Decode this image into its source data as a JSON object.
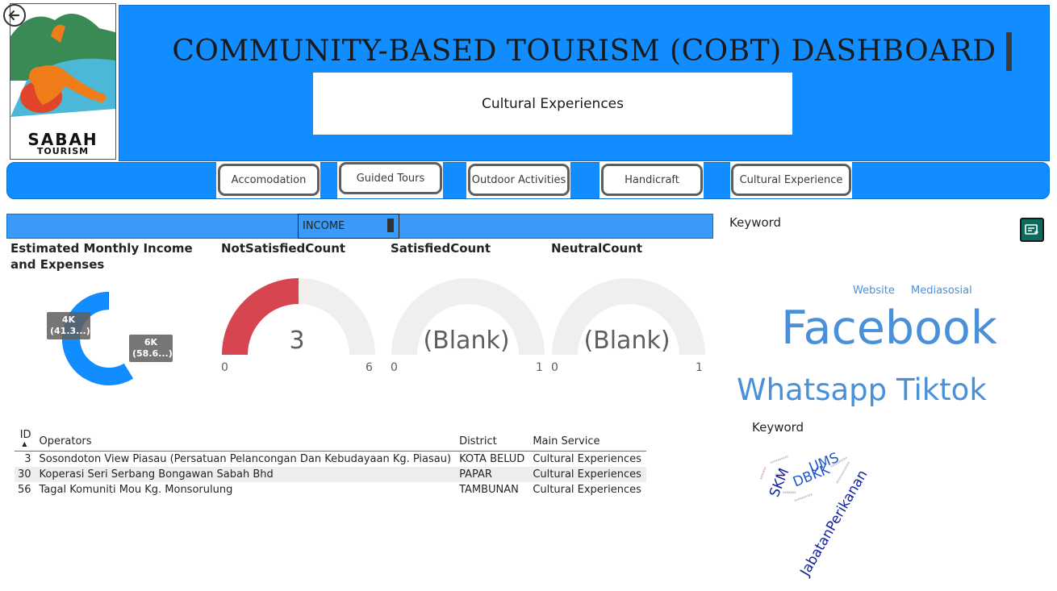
{
  "header": {
    "title": "COMMUNITY-BASED TOURISM (COBT) DASHBOARD",
    "subtitle": "Cultural Experiences",
    "logo_text_1": "SABAH",
    "logo_text_2": "TOURISM"
  },
  "nav": {
    "items": [
      {
        "label": "Accomodation"
      },
      {
        "label": "Guided Tours"
      },
      {
        "label": "Outdoor Activities"
      },
      {
        "label": "Handicraft"
      },
      {
        "label": "Cultural Experience"
      }
    ]
  },
  "slicer": {
    "label": "INCOME"
  },
  "donut": {
    "title": "Estimated Monthly Income and Expenses",
    "slices": [
      {
        "label_value": "4K",
        "label_pct": "(41.3...)",
        "fraction": 0.413,
        "color": "#12239e"
      },
      {
        "label_value": "6K",
        "label_pct": "(58.6...)",
        "fraction": 0.586,
        "color": "#118dff"
      }
    ]
  },
  "gauges": [
    {
      "title": "NotSatisfiedCount",
      "value_text": "3",
      "fraction": 0.5,
      "min": "0",
      "max": "6",
      "fill": "#d64550"
    },
    {
      "title": "SatisfiedCount",
      "value_text": "(Blank)",
      "fraction": 0,
      "min": "0",
      "max": "1",
      "fill": "#d64550"
    },
    {
      "title": "NeutralCount",
      "value_text": "(Blank)",
      "fraction": 0,
      "min": "0",
      "max": "1",
      "fill": "#d64550"
    }
  ],
  "table": {
    "headers": {
      "id": "ID",
      "operators": "Operators",
      "district": "District",
      "service": "Main Service"
    },
    "rows": [
      {
        "id": "3",
        "operators": "Sosondoton View Piasau (Persatuan Pelancongan Dan Kebudayaan Kg. Piasau)",
        "district": "KOTA BELUD",
        "service": "Cultural Experiences"
      },
      {
        "id": "30",
        "operators": "Koperasi Seri Serbang Bongawan Sabah Bhd",
        "district": "PAPAR",
        "service": "Cultural Experiences"
      },
      {
        "id": "56",
        "operators": "Tagal Komuniti Mou Kg. Monsorulung",
        "district": "TAMBUNAN",
        "service": "Cultural Experiences"
      }
    ]
  },
  "keywords1": {
    "title": "Keyword",
    "words": [
      "Website",
      "Mediasosial",
      "Facebook",
      "Whatsapp",
      "Tiktok"
    ]
  },
  "keywords2": {
    "title": "Keyword",
    "words": [
      "UMS",
      "DBKK",
      "SKM",
      "JabatanPerikanan"
    ]
  },
  "colors": {
    "accent": "#118dff",
    "dark_blue": "#12239e",
    "red": "#d64550",
    "keyword_blue": "#4a90d9",
    "export_green": "#0d6b5e"
  }
}
